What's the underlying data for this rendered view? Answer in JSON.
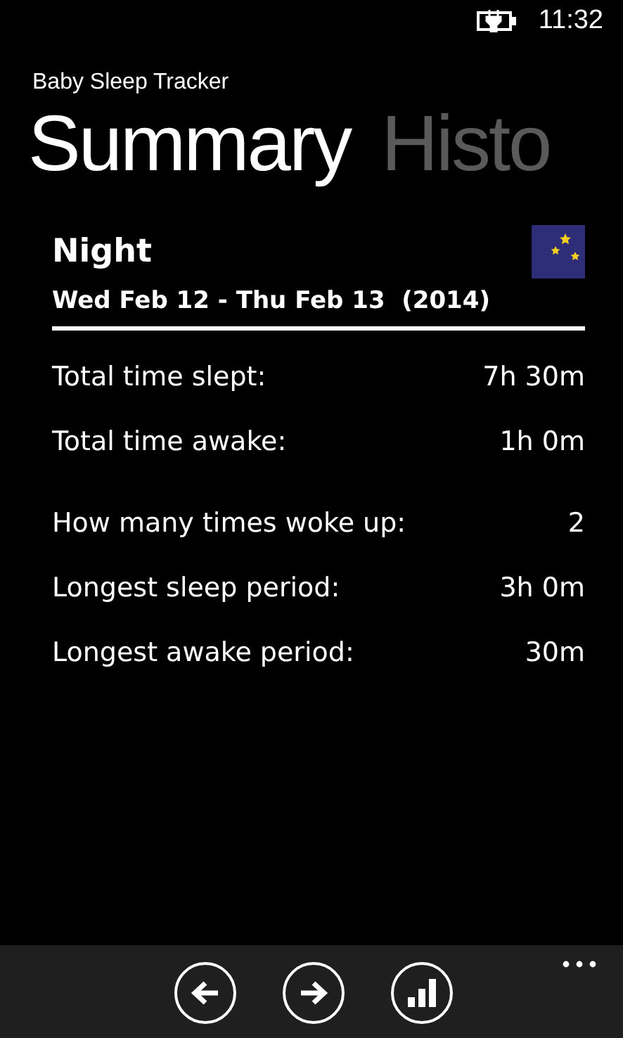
{
  "status_bar": {
    "time": "11:32"
  },
  "app_title": "Baby Sleep Tracker",
  "pivots": [
    {
      "label": "Summary",
      "selected": true
    },
    {
      "label": "Histo",
      "selected": false
    }
  ],
  "summary": {
    "title": "Night",
    "date_range": "Wed Feb 12 - Thu Feb 13  (2014)",
    "sections": [
      {
        "rows": [
          {
            "label": "Total time slept:",
            "value": "7h 30m"
          },
          {
            "label": "Total time awake:",
            "value": "1h 0m"
          }
        ]
      },
      {
        "rows": [
          {
            "label": "How many times woke up:",
            "value": "2"
          },
          {
            "label": "Longest sleep period:",
            "value": "3h 0m"
          },
          {
            "label": "Longest awake period:",
            "value": "30m"
          }
        ]
      }
    ]
  },
  "app_bar": {
    "buttons": [
      {
        "kind": "back"
      },
      {
        "kind": "forward"
      },
      {
        "kind": "chart"
      }
    ]
  }
}
